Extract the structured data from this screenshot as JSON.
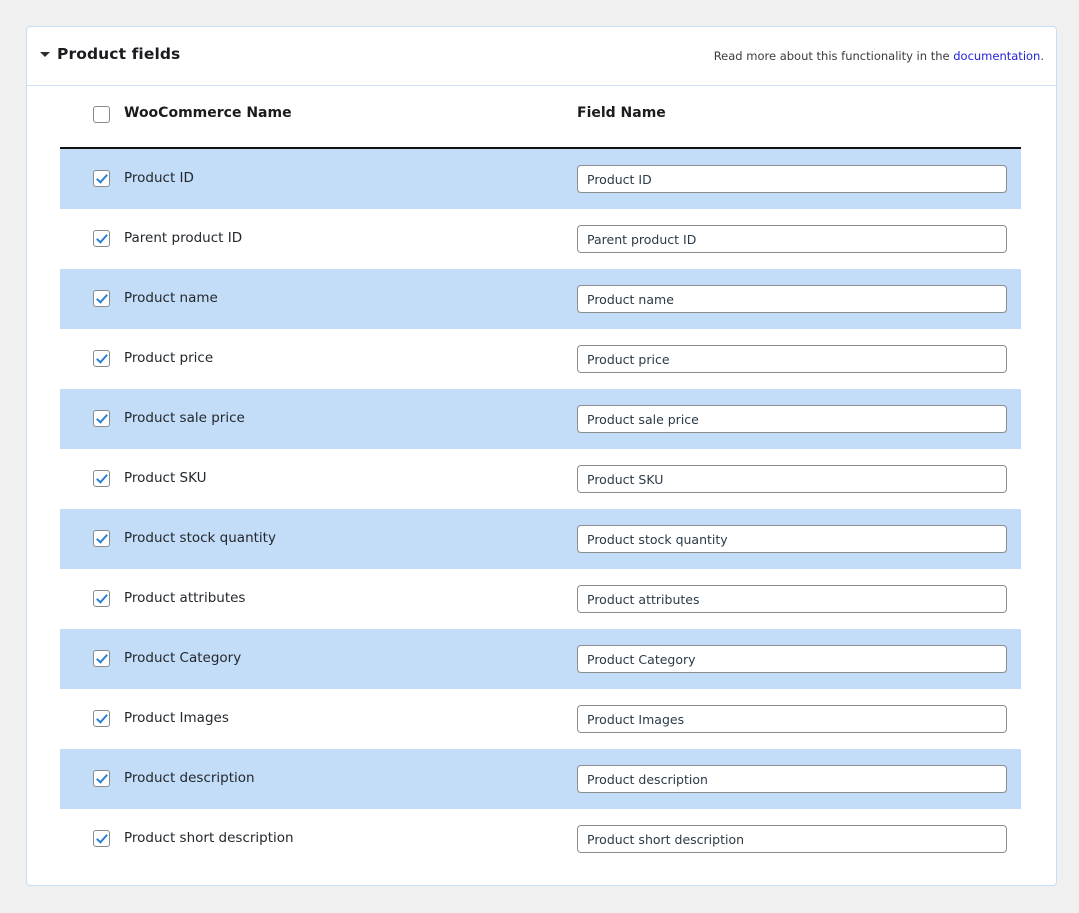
{
  "panel": {
    "title": "Product fields",
    "toggle_icon": "chevron-down-icon",
    "note_prefix": "Read more about this functionality in the ",
    "note_link": "documentation",
    "note_suffix": "."
  },
  "table": {
    "header": {
      "select_all_checked": false,
      "col_name": "WooCommerce Name",
      "col_field": "Field Name"
    },
    "rows": [
      {
        "checked": true,
        "label": "Product ID",
        "value": "Product ID"
      },
      {
        "checked": true,
        "label": "Parent product ID",
        "value": "Parent product ID"
      },
      {
        "checked": true,
        "label": "Product name",
        "value": "Product name"
      },
      {
        "checked": true,
        "label": "Product price",
        "value": "Product price"
      },
      {
        "checked": true,
        "label": "Product sale price",
        "value": "Product sale price"
      },
      {
        "checked": true,
        "label": "Product SKU",
        "value": "Product SKU"
      },
      {
        "checked": true,
        "label": "Product stock quantity",
        "value": "Product stock quantity"
      },
      {
        "checked": true,
        "label": "Product attributes",
        "value": "Product attributes"
      },
      {
        "checked": true,
        "label": "Product Category",
        "value": "Product Category"
      },
      {
        "checked": true,
        "label": "Product Images",
        "value": "Product Images"
      },
      {
        "checked": true,
        "label": "Product description",
        "value": "Product description"
      },
      {
        "checked": true,
        "label": "Product short description",
        "value": "Product short description"
      }
    ]
  },
  "colors": {
    "page_background": "#f0f0f0",
    "panel_border": "#c8def6",
    "row_stripe": "#c3dcf7",
    "link": "#2222dd",
    "checkmark": "#2a7fd4",
    "header_rule": "#111111"
  }
}
